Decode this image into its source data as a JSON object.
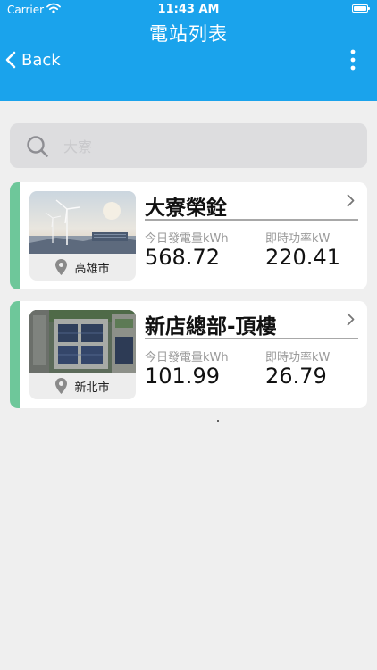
{
  "status_bar": {
    "carrier": "Carrier",
    "time": "11:43 AM"
  },
  "nav": {
    "title": "電站列表",
    "back_label": "Back"
  },
  "search": {
    "placeholder": "大寮",
    "value": ""
  },
  "colors": {
    "header": "#1aa3ec",
    "accent": "#6ec79a",
    "background": "#efefef"
  },
  "stations": [
    {
      "name": "大寮榮銓",
      "city": "高雄市",
      "energy_label": "今日發電量kWh",
      "energy_value": "568.72",
      "power_label": "即時功率kW",
      "power_value": "220.41"
    },
    {
      "name": "新店總部-頂樓",
      "city": "新北市",
      "energy_label": "今日發電量kWh",
      "energy_value": "101.99",
      "power_label": "即時功率kW",
      "power_value": "26.79"
    }
  ]
}
